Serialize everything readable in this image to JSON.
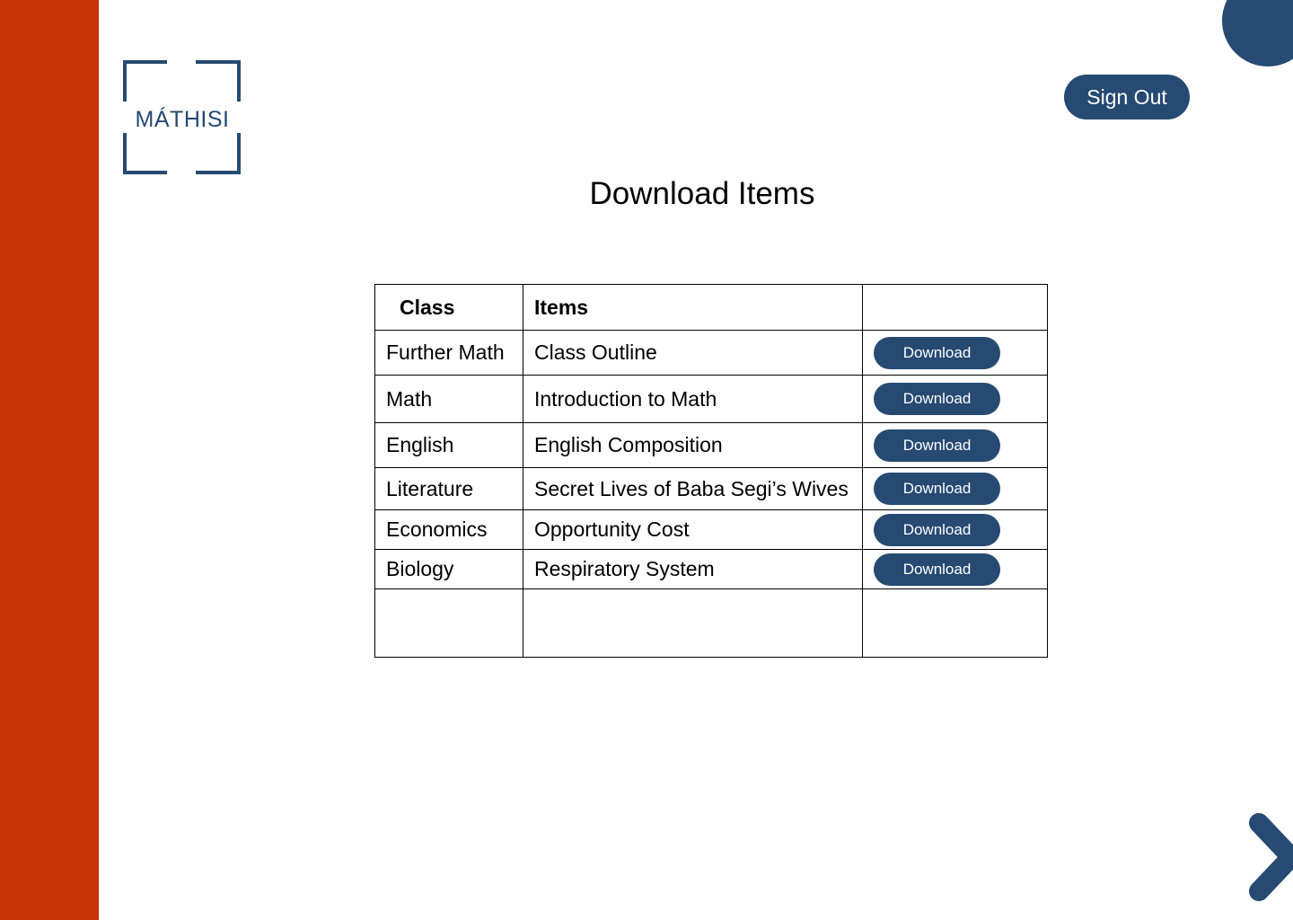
{
  "brand": {
    "logo_text": "MÁTHISI"
  },
  "header": {
    "sign_out_label": "Sign Out"
  },
  "page": {
    "title": "Download Items"
  },
  "table": {
    "headers": {
      "class": "Class",
      "items": "Items",
      "action": ""
    },
    "rows": [
      {
        "class": "Further Math",
        "item": "Class Outline",
        "action": "Download"
      },
      {
        "class": "Math",
        "item": "Introduction to Math",
        "action": "Download"
      },
      {
        "class": "English",
        "item": "English Composition",
        "action": "Download"
      },
      {
        "class": "Literature",
        "item": "Secret Lives of Baba Segi’s Wives",
        "action": "Download"
      },
      {
        "class": "Economics",
        "item": "Opportunity Cost",
        "action": "Download"
      },
      {
        "class": "Biology",
        "item": "Respiratory System",
        "action": "Download"
      }
    ]
  },
  "nav": {
    "next_icon": "chevron-right-icon"
  },
  "colors": {
    "sidebar": "#c53206",
    "primary": "#264a72",
    "background": "#ffffff"
  }
}
